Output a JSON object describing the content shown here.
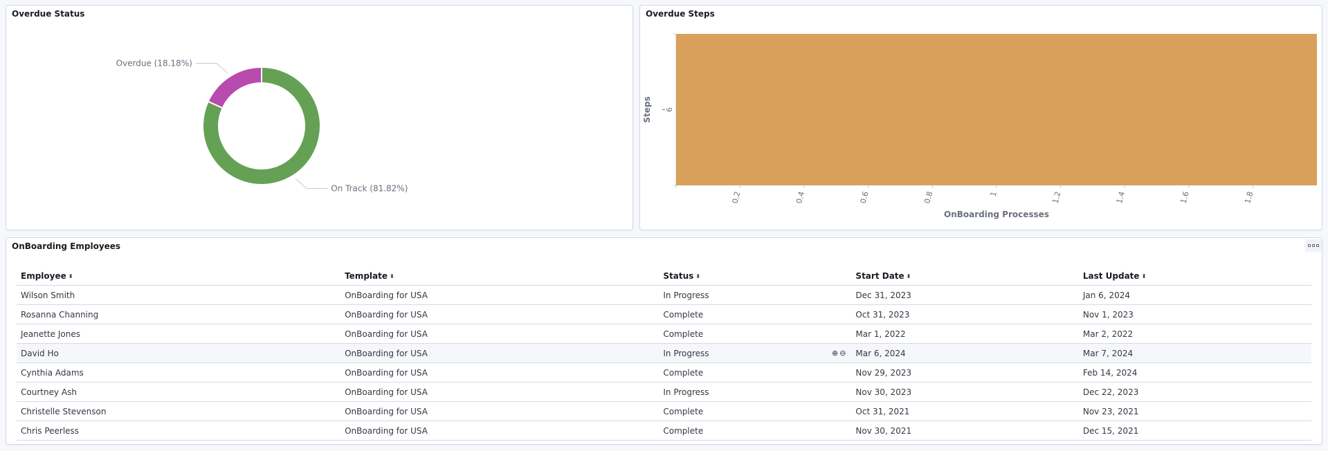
{
  "overdue_status": {
    "title": "Overdue Status",
    "chart_data": {
      "type": "pie",
      "slices": [
        {
          "label": "Overdue (18.18%)",
          "value": 18.18,
          "color": "#b84bae"
        },
        {
          "label": "On Track (81.82%)",
          "value": 81.82,
          "color": "#65a155"
        }
      ]
    }
  },
  "overdue_steps": {
    "title": "Overdue Steps",
    "chart_data": {
      "type": "bar",
      "orientation": "horizontal",
      "color": "#d9a05b",
      "categories": [
        "9"
      ],
      "x_ticks": [
        "0.2",
        "0.4",
        "0.6",
        "0.8",
        "1",
        "1.2",
        "1.4",
        "1.6",
        "1.8"
      ],
      "xlim": [
        0,
        2
      ],
      "values": [
        2
      ],
      "xlabel": "OnBoarding Processes",
      "ylabel": "Steps"
    }
  },
  "employees": {
    "title": "OnBoarding Employees",
    "columns": [
      "Employee",
      "Template",
      "Status",
      "Start Date",
      "Last Update"
    ],
    "rows": [
      [
        "Wilson Smith",
        "OnBoarding for USA",
        "In Progress",
        "Dec 31, 2023",
        "Jan 6, 2024"
      ],
      [
        "Rosanna Channing",
        "OnBoarding for USA",
        "Complete",
        "Oct 31, 2023",
        "Nov 1, 2023"
      ],
      [
        "Jeanette Jones",
        "OnBoarding for USA",
        "Complete",
        "Mar 1, 2022",
        "Mar 2, 2022"
      ],
      [
        "David Ho",
        "OnBoarding for USA",
        "In Progress",
        "Mar 6, 2024",
        "Mar 7, 2024"
      ],
      [
        "Cynthia Adams",
        "OnBoarding for USA",
        "Complete",
        "Nov 29, 2023",
        "Feb 14, 2024"
      ],
      [
        "Courtney Ash",
        "OnBoarding for USA",
        "In Progress",
        "Nov 30, 2023",
        "Dec 22, 2023"
      ],
      [
        "Christelle Stevenson",
        "OnBoarding for USA",
        "Complete",
        "Oct 31, 2021",
        "Nov 23, 2021"
      ],
      [
        "Chris Peerless",
        "OnBoarding for USA",
        "Complete",
        "Nov 30, 2021",
        "Dec 15, 2021"
      ]
    ],
    "hover_row": 3,
    "hover_icons": [
      "zoom-in-icon",
      "zoom-out-icon"
    ],
    "sort_icon": "sort-icon",
    "options_icon": "panel-options-icon"
  }
}
